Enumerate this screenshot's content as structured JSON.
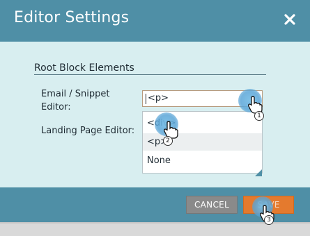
{
  "dialog": {
    "title": "Editor Settings",
    "close_icon": "close-icon"
  },
  "section": {
    "title": "Root Block Elements"
  },
  "fields": {
    "email_label": "Email / Snippet Editor:",
    "landing_label": "Landing Page Editor:"
  },
  "select": {
    "value": "<p>",
    "options": [
      "<div>",
      "<p>",
      "None"
    ]
  },
  "buttons": {
    "cancel": "CANCEL",
    "save": "SAVE"
  },
  "steps": [
    "1",
    "2",
    "3"
  ],
  "colors": {
    "header": "#4f8fa6",
    "body": "#d8eef0",
    "save": "#e47a2e",
    "cancel": "#8a8a8a"
  }
}
